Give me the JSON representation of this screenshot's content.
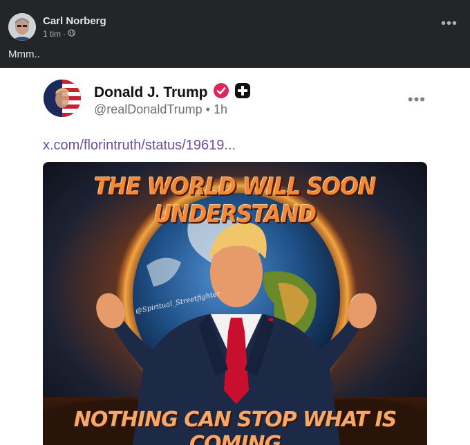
{
  "post": {
    "author": "Carl Norberg",
    "time": "1 tim",
    "separator": "·",
    "caption": "Mmm..",
    "more": "•••"
  },
  "shared": {
    "name": "Donald J. Trump",
    "handle": "@realDonaldTrump • 1h",
    "link": "x.com/florintruth/status/19619...",
    "more": "•••",
    "image": {
      "headline": "THE WORLD WILL SOON UNDERSTAND",
      "footer": "NOTHING CAN STOP WHAT IS COMING",
      "signature": "@Spiritual_Streetfighter"
    }
  },
  "colors": {
    "header_bg": "#242526",
    "verified_badge": "#e0245e",
    "link": "#6a4f9d"
  }
}
